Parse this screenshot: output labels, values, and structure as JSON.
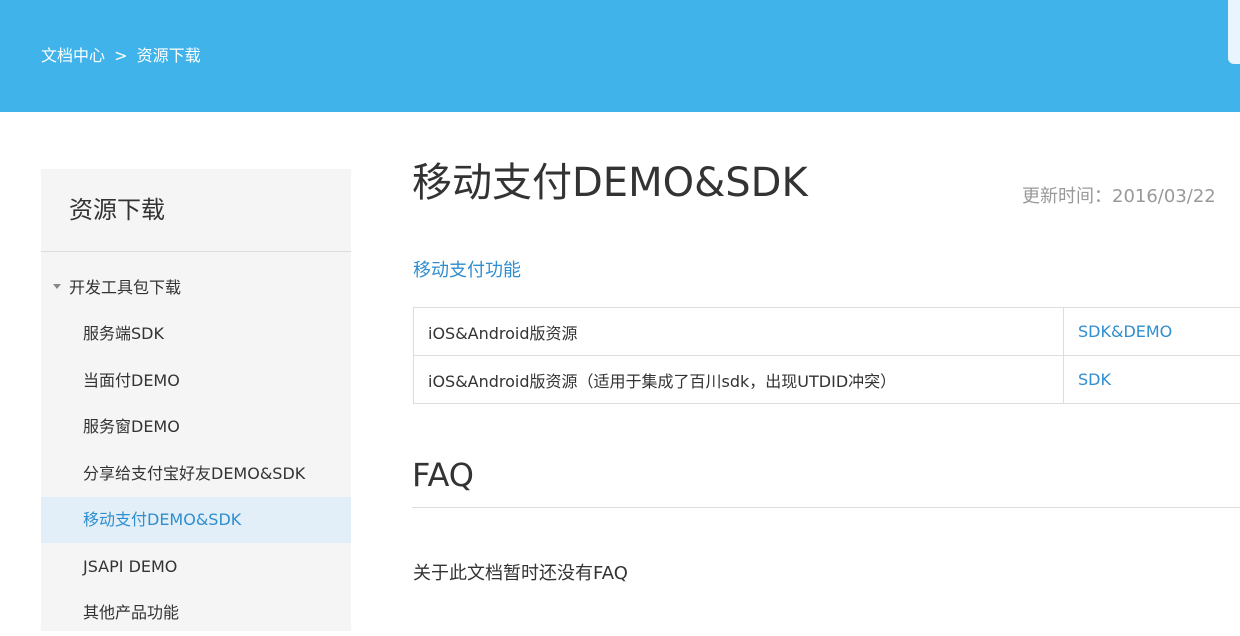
{
  "header": {
    "breadcrumb_root": "文档中心",
    "breadcrumb_sep": ">",
    "breadcrumb_current": "资源下载"
  },
  "sidebar": {
    "title": "资源下载",
    "group_label": "开发工具包下载",
    "items": [
      {
        "label": "服务端SDK",
        "active": false
      },
      {
        "label": "当面付DEMO",
        "active": false
      },
      {
        "label": "服务窗DEMO",
        "active": false
      },
      {
        "label": "分享给支付宝好友DEMO&SDK",
        "active": false
      },
      {
        "label": "移动支付DEMO&SDK",
        "active": true
      },
      {
        "label": "JSAPI DEMO",
        "active": false
      },
      {
        "label": "其他产品功能",
        "active": false
      }
    ]
  },
  "main": {
    "title": "移动支付DEMO&SDK",
    "update_time": "更新时间：2016/03/22",
    "section_link": "移动支付功能",
    "resources": [
      {
        "name": "iOS&Android版资源",
        "link": "SDK&DEMO"
      },
      {
        "name": "iOS&Android版资源（适用于集成了百川sdk，出现UTDID冲突）",
        "link": "SDK"
      }
    ],
    "faq_title": "FAQ",
    "faq_empty": "关于此文档暂时还没有FAQ"
  },
  "colors": {
    "header_bg": "#3fb3ea",
    "link": "#2f8ecf",
    "sidebar_bg": "#f5f5f5",
    "active_bg": "#e2eff8"
  }
}
